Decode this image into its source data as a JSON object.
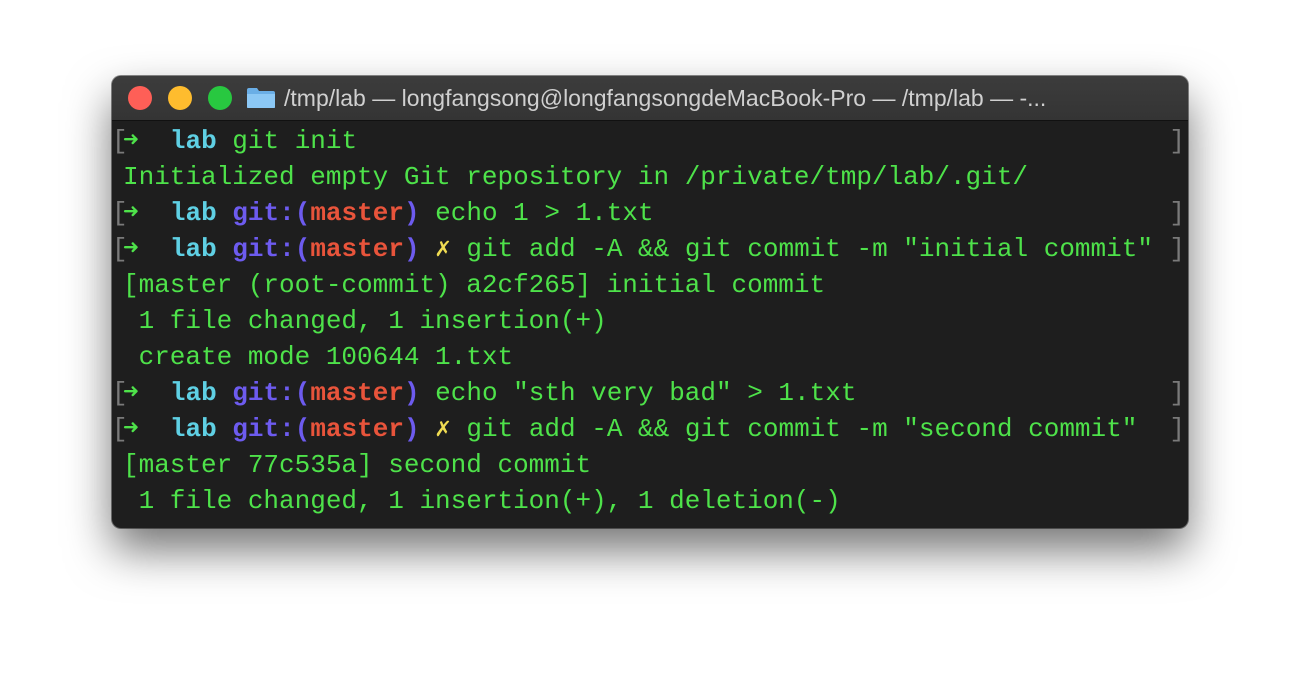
{
  "window": {
    "title": "/tmp/lab — longfangsong@longfangsongdeMacBook-Pro — /tmp/lab — -..."
  },
  "prompt": {
    "arrow": "➜",
    "dir": "lab",
    "git_prefix": "git:(",
    "git_suffix": ")",
    "dirty_mark": "✗",
    "bracket_left": "[",
    "bracket_right": "]"
  },
  "lines": [
    {
      "kind": "prompt",
      "branch": "",
      "dirty": false,
      "command": "git init"
    },
    {
      "kind": "output",
      "text": "Initialized empty Git repository in /private/tmp/lab/.git/"
    },
    {
      "kind": "prompt",
      "branch": "master",
      "dirty": false,
      "command": "echo 1 > 1.txt"
    },
    {
      "kind": "prompt",
      "branch": "master",
      "dirty": true,
      "command": "git add -A && git commit -m \"initial commit\""
    },
    {
      "kind": "output",
      "text": "[master (root-commit) a2cf265] initial commit"
    },
    {
      "kind": "output",
      "text": " 1 file changed, 1 insertion(+)"
    },
    {
      "kind": "output",
      "text": " create mode 100644 1.txt"
    },
    {
      "kind": "prompt",
      "branch": "master",
      "dirty": false,
      "command": "echo \"sth very bad\" > 1.txt"
    },
    {
      "kind": "prompt",
      "branch": "master",
      "dirty": true,
      "command": "git add -A && git commit -m \"second commit\""
    },
    {
      "kind": "output",
      "text": "[master 77c535a] second commit"
    },
    {
      "kind": "output",
      "text": " 1 file changed, 1 insertion(+), 1 deletion(-)"
    }
  ],
  "colors": {
    "terminal_bg": "#1e1e1e",
    "text_green": "#4ee24a",
    "dir_cyan": "#5fd0e4",
    "git_purple": "#6d5bef",
    "branch_red": "#e8543b",
    "dirty_yellow": "#f0dc52",
    "close": "#fe5f57",
    "minimize": "#febc2e",
    "maximize": "#28c840"
  }
}
